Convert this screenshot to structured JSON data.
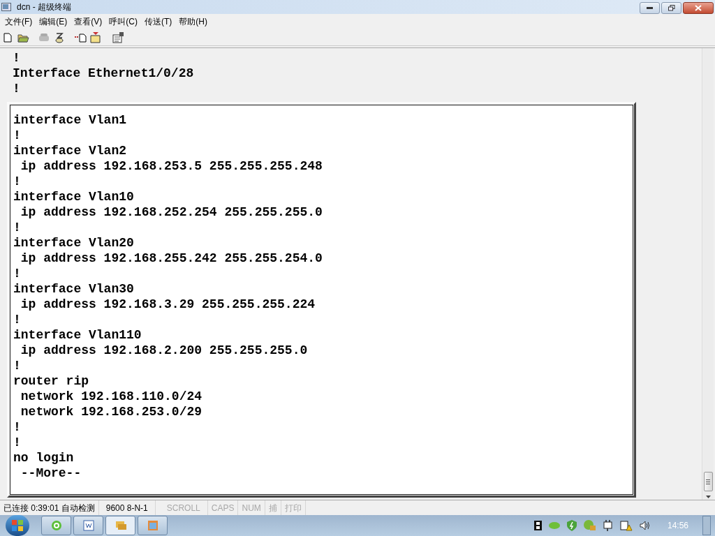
{
  "window": {
    "title": "dcn - 超级终端"
  },
  "menu": [
    "文件(F)",
    "编辑(E)",
    "查看(V)",
    "呼叫(C)",
    "传送(T)",
    "帮助(H)"
  ],
  "terminal": {
    "top_lines": [
      "!",
      "Interface Ethernet1/0/28",
      "!"
    ],
    "box_lines": [
      "interface Vlan1",
      "!",
      "interface Vlan2",
      " ip address 192.168.253.5 255.255.255.248",
      "!",
      "interface Vlan10",
      " ip address 192.168.252.254 255.255.255.0",
      "!",
      "interface Vlan20",
      " ip address 192.168.255.242 255.255.254.0",
      "!",
      "interface Vlan30",
      " ip address 192.168.3.29 255.255.255.224",
      "!",
      "interface Vlan110",
      " ip address 192.168.2.200 255.255.255.0",
      "!",
      "router rip",
      " network 192.168.110.0/24",
      " network 192.168.253.0/29",
      "!",
      "!",
      "no login",
      " --More--"
    ]
  },
  "status_bar": [
    {
      "text": "已连接 0:39:01 自动检测",
      "disabled": false
    },
    {
      "text": "9600 8-N-1",
      "disabled": false
    },
    {
      "text": "SCROLL",
      "disabled": true
    },
    {
      "text": "CAPS",
      "disabled": true
    },
    {
      "text": "NUM",
      "disabled": true
    },
    {
      "text": "捕",
      "disabled": true
    },
    {
      "text": "打印",
      "disabled": true
    }
  ],
  "taskbar": {
    "clock": "14:56"
  }
}
